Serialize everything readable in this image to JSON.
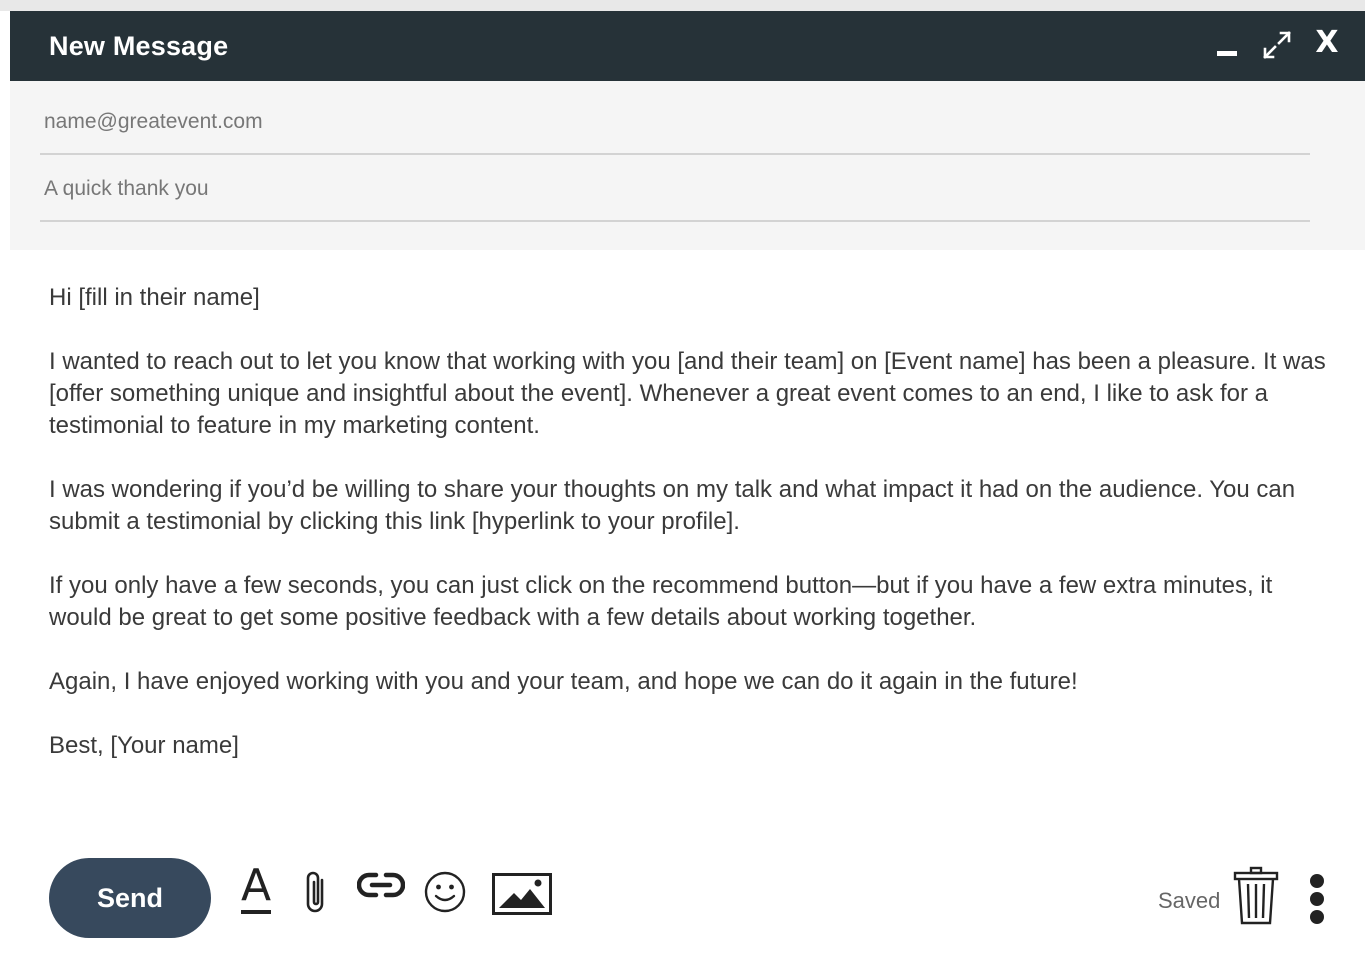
{
  "window": {
    "title": "New Message",
    "minimize_icon": "minimize-icon",
    "expand_icon": "expand-icon",
    "close_icon": "close-icon",
    "close_label": "X",
    "title_bar_color": "#263238"
  },
  "fields": {
    "to_placeholder": "name@greatevent.com",
    "subject_placeholder": "A quick thank you"
  },
  "body": {
    "paragraphs": [
      "Hi [fill in their name]",
      "I wanted to reach out to let you know that working with you [and their team] on [Event name] has been a pleasure. It was [offer something unique and insightful about the event].  Whenever a great event comes to an end, I like to ask for a testimonial to feature in my marketing content.",
      "I was wondering if you’d be willing to share your thoughts on my talk and what impact it had on the audience. You can submit a testimonial by clicking this link [hyperlink to your profile].",
      "If you only have a few seconds, you can just click on the recommend button—but if you have a few extra minutes, it would be great to get some positive feedback with a few details about working together.",
      "Again, I have enjoyed working with you and your team, and hope we can do it again in the future!",
      "Best, [Your name]"
    ]
  },
  "toolbar": {
    "send_label": "Send",
    "send_color": "#37495d",
    "format_glyph": "A",
    "tools": [
      "text-format-icon",
      "paperclip-icon",
      "link-icon",
      "emoji-icon",
      "image-icon"
    ],
    "status": "Saved",
    "delete_icon": "trash-icon",
    "more_icon": "more-vertical-icon"
  }
}
